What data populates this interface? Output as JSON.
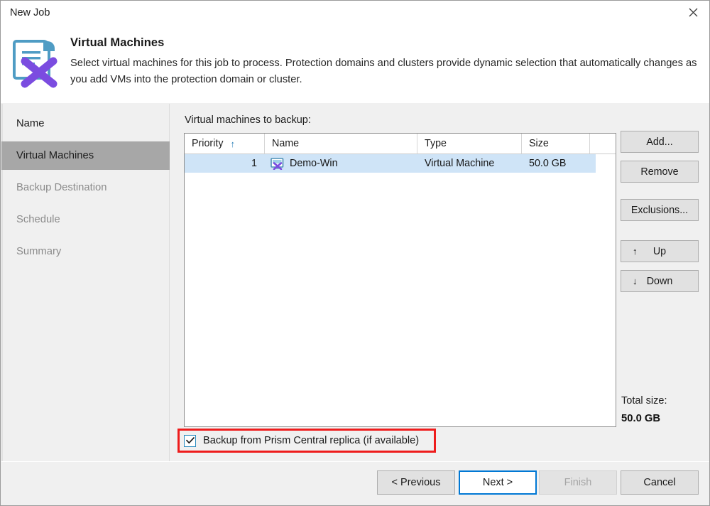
{
  "window": {
    "title": "New Job",
    "close_icon": "close-icon"
  },
  "header": {
    "icon": "job-document-x-icon",
    "title": "Virtual Machines",
    "description": "Select virtual machines for this job to process. Protection domains and clusters provide dynamic selection that automatically changes as you add VMs into the protection domain or cluster."
  },
  "sidebar": {
    "items": [
      {
        "label": "Name",
        "state": "enabled"
      },
      {
        "label": "Virtual Machines",
        "state": "active"
      },
      {
        "label": "Backup Destination",
        "state": "disabled"
      },
      {
        "label": "Schedule",
        "state": "disabled"
      },
      {
        "label": "Summary",
        "state": "disabled"
      }
    ]
  },
  "main": {
    "list_label": "Virtual machines to backup:",
    "table": {
      "columns": [
        "Priority",
        "Name",
        "Type",
        "Size"
      ],
      "sort_column": "Priority",
      "sort_arrow": "↑",
      "rows": [
        {
          "priority": "1",
          "icon": "virtual-machine-x-icon",
          "name": "Demo-Win",
          "type": "Virtual Machine",
          "size": "50.0 GB",
          "selected": true
        }
      ]
    },
    "buttons": [
      {
        "label": "Add...",
        "icon": ""
      },
      {
        "label": "Remove",
        "icon": ""
      },
      {
        "label": "Exclusions...",
        "icon": ""
      },
      {
        "label": "Up",
        "icon": "↑"
      },
      {
        "label": "Down",
        "icon": "↓"
      }
    ],
    "total_size_label": "Total size:",
    "total_size_value": "50.0 GB",
    "checkbox": {
      "label": "Backup from Prism Central replica (if available)",
      "checked": true,
      "highlighted": true
    }
  },
  "footer": {
    "previous": "< Previous",
    "next": "Next >",
    "finish": "Finish",
    "cancel": "Cancel"
  },
  "colors": {
    "accent": "#0078d4",
    "annotation": "#ee1c1c",
    "row_selected": "#cfe4f7",
    "nav_active": "#a7a7a7",
    "sort_arrow": "#2a7fb8",
    "icon_purple": "#7b4ce0",
    "icon_blue": "#4f9cc4"
  }
}
